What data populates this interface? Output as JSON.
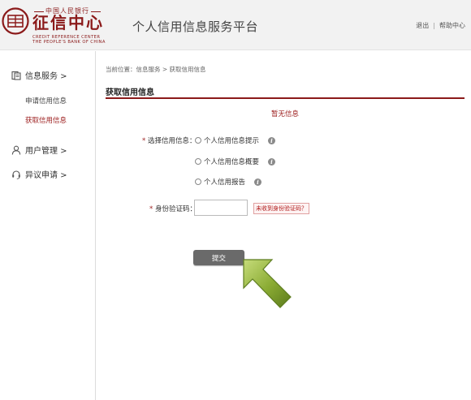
{
  "header": {
    "logo_top": "中国人民银行",
    "logo_main": "征信中心",
    "logo_en_line1": "CREDIT REFERENCE CENTER",
    "logo_en_line2": "THE PEOPLE'S BANK OF CHINA",
    "platform_title": "个人信用信息服务平台",
    "links": {
      "logout": "退出",
      "help": "帮助中心",
      "separator": "|"
    }
  },
  "sidebar": {
    "sections": [
      {
        "label": "信息服务 >",
        "icon": "document-icon"
      },
      {
        "label": "用户管理 >",
        "icon": "user-icon"
      },
      {
        "label": "异议申请 >",
        "icon": "headset-icon"
      }
    ],
    "sub_items": [
      {
        "label": "申请信用信息",
        "active": false
      },
      {
        "label": "获取信用信息",
        "active": true
      }
    ]
  },
  "main": {
    "breadcrumb": "当前位置：信息服务 > 获取信用信息",
    "section_title": "获取信用信息",
    "notice": "暂无信息",
    "select_label_req": "*",
    "select_label": "选择信用信息：",
    "options": [
      {
        "label": "个人信用信息提示",
        "selected": false
      },
      {
        "label": "个人信用信息概要",
        "selected": false
      },
      {
        "label": "个人信用报告",
        "selected": false
      }
    ],
    "code_label_req": "*",
    "code_label": "身份验证码：",
    "code_value": "",
    "code_link": "未收到身份验证码？",
    "submit_label": "提交"
  },
  "colors": {
    "brand": "#8b1a1a",
    "button": "#6a6a6a",
    "arrow": "#7a9a2a"
  }
}
